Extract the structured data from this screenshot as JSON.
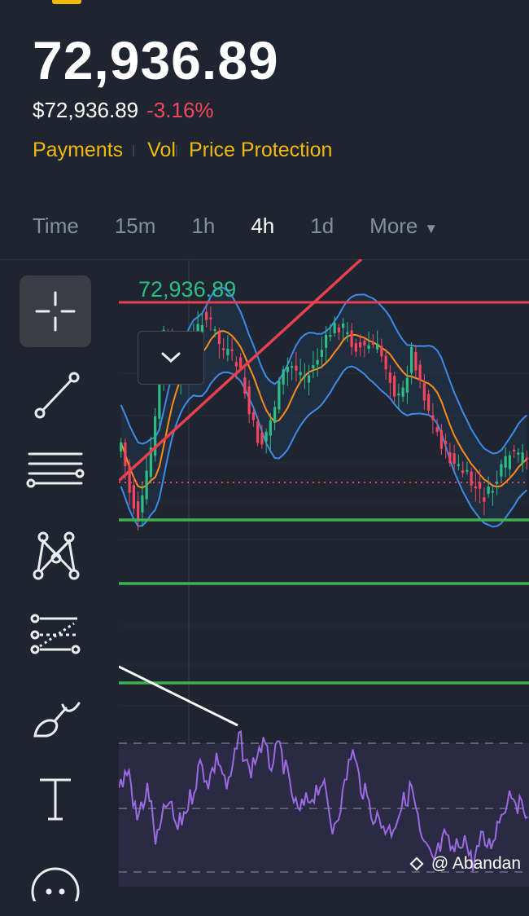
{
  "price": {
    "last": "72,936.89",
    "usd": "$72,936.89",
    "change": "-3.16%"
  },
  "links": [
    "Payments",
    "Vol",
    "Price Protection"
  ],
  "timeframes": [
    "Time",
    "15m",
    "1h",
    "4h",
    "1d",
    "More"
  ],
  "active_timeframe": "4h",
  "chart_price_label": "72,936.89",
  "tools": [
    "crosshair-icon",
    "trend-line-icon",
    "horizontal-lines-icon",
    "pattern-icon",
    "fibonacci-icon",
    "brush-icon",
    "text-icon",
    "more-icon"
  ],
  "watermark": "@ Abandan",
  "colors": {
    "up": "#2ebd85",
    "down": "#f6465d",
    "bollinger": "#3d8be6",
    "ma": "#ff8c1a",
    "indicator": "#9c6ae0",
    "support": "#3fb24f",
    "resistance": "#e8404f",
    "accent": "#f0b90b"
  }
}
